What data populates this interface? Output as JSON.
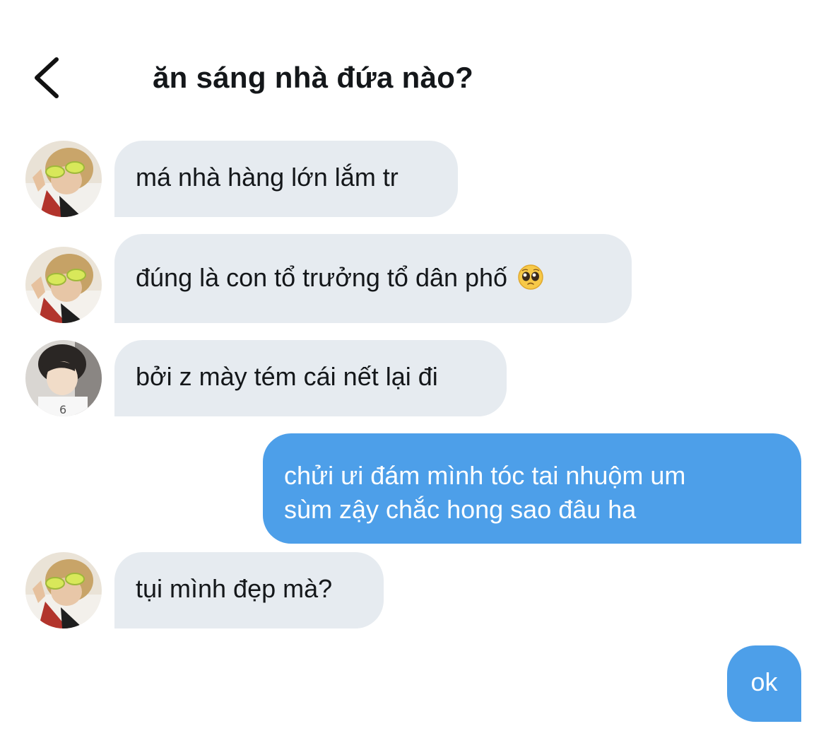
{
  "header": {
    "title": "ăn sáng nhà đứa nào?",
    "back_icon": "chevron-left-icon"
  },
  "messages": [
    {
      "direction": "incoming",
      "sender_avatar": "avatar-blond-sunglasses",
      "text": "má nhà hàng lớn lắm tr"
    },
    {
      "direction": "incoming",
      "sender_avatar": "avatar-blond-sunglasses",
      "text": "đúng là con tổ trưởng tổ dân phố",
      "emoji": "pleading-face-emoji"
    },
    {
      "direction": "incoming",
      "sender_avatar": "avatar-dark-hair",
      "text": "bởi z mày tém cái nết lại đi"
    },
    {
      "direction": "outgoing",
      "lines": [
        "chửi ưi đám mình tóc tai nhuộm um",
        "sùm zậy chắc hong sao đâu ha"
      ]
    },
    {
      "direction": "incoming",
      "sender_avatar": "avatar-blond-sunglasses",
      "text": "tụi mình đẹp mà?"
    },
    {
      "direction": "outgoing",
      "text": "ok"
    }
  ],
  "colors": {
    "incoming_bubble": "#e6ebf0",
    "outgoing_bubble": "#4d9fe9",
    "text_dark": "#14171a",
    "text_light": "#ffffff"
  }
}
